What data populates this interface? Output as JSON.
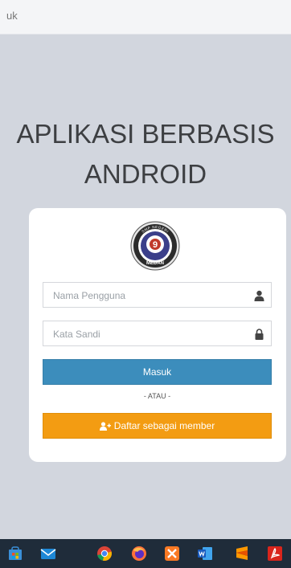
{
  "tab": {
    "title": "uk"
  },
  "page": {
    "title_line1": "APLIKASI BERBASIS",
    "title_line2": "ANDROID"
  },
  "logo": {
    "top_text": "SMP NEGERI",
    "number": "9",
    "bottom_text": "MEDAN",
    "colors": {
      "ring": "#2b2b2b",
      "inner": "#3b3f8a",
      "accent": "#c0392b"
    }
  },
  "form": {
    "username_placeholder": "Nama Pengguna",
    "username_icon": "user-icon",
    "password_placeholder": "Kata Sandi",
    "password_icon": "lock-icon",
    "login_label": "Masuk",
    "separator": "- ATAU -",
    "register_label": "Daftar sebagai member",
    "register_icon": "user-plus-icon"
  },
  "colors": {
    "background": "#d2d6de",
    "login_button": "#3c8dbc",
    "register_button": "#f39c12",
    "taskbar": "#1f2c3a"
  },
  "taskbar": {
    "icons": [
      "store-icon",
      "mail-icon",
      "chrome-icon",
      "firefox-icon",
      "xampp-icon",
      "word-icon",
      "sublime-icon",
      "acrobat-icon"
    ]
  }
}
